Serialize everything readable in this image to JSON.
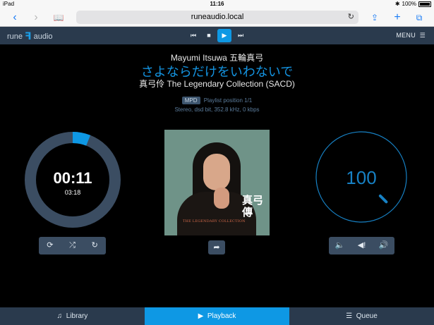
{
  "status_bar": {
    "device": "iPad",
    "wifi_icon": "wifi-icon",
    "time": "11:16",
    "battery_percent": "100%",
    "bluetooth_icon": "bluetooth-icon"
  },
  "browser": {
    "url": "runeaudio.local",
    "back_icon": "chevron-left-icon",
    "forward_icon": "chevron-right-icon",
    "bookmarks_icon": "book-icon",
    "reload_icon": "reload-icon",
    "share_icon": "share-icon",
    "new_tab_icon": "plus-icon",
    "tabs_icon": "tabs-icon"
  },
  "header": {
    "logo_left": "rune",
    "logo_right": "audio",
    "transport": {
      "prev": "⏮",
      "stop": "■",
      "play": "▶",
      "next": "⏭"
    },
    "menu_label": "MENU"
  },
  "track": {
    "artist": "Mayumi Itsuwa 五輪真弓",
    "title": "さよならだけをいわないで",
    "album": "真弓伶 The Legendary Collection (SACD)",
    "source_badge": "MPD",
    "playlist_position": "Playlist position 1/1",
    "format": "Stereo, dsd bit, 352.8 kHz, 0 kbps"
  },
  "playback": {
    "elapsed": "00:11",
    "duration": "03:18",
    "progress_fraction": 0.06,
    "controls": [
      "repeat-icon",
      "shuffle-icon",
      "single-icon"
    ]
  },
  "cover": {
    "kanji_top": "真弓",
    "kanji_bottom": "傳",
    "legend_text": "THE LEGENDARY COLLECTION"
  },
  "volume": {
    "value": "100",
    "level_fraction": 1.0,
    "controls": [
      "volume-down-icon",
      "mute-icon",
      "volume-up-icon"
    ]
  },
  "tabs": [
    {
      "label": "Library",
      "icon": "music-note-icon"
    },
    {
      "label": "Playback",
      "icon": "play-icon"
    },
    {
      "label": "Queue",
      "icon": "list-icon"
    }
  ],
  "colors": {
    "accent": "#0e98e4",
    "panel": "#2a3a4d",
    "ring": "#3b4d62"
  }
}
